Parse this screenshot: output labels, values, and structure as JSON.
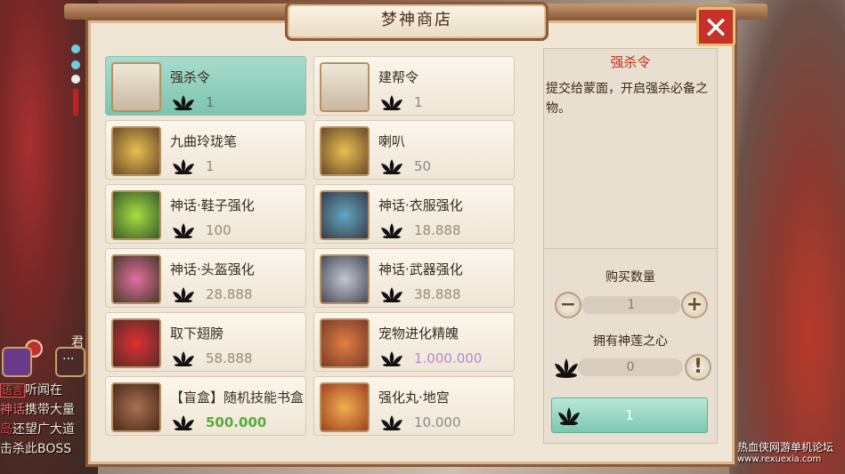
{
  "window": {
    "title": "梦神商店"
  },
  "items": [
    {
      "name": "强杀令",
      "price": "1",
      "icon": "seal-scroll-icon",
      "selected": true
    },
    {
      "name": "建帮令",
      "price": "1",
      "icon": "scroll-icon"
    },
    {
      "name": "九曲玲珑笔",
      "price": "1",
      "icon": "brush-icon"
    },
    {
      "name": "喇叭",
      "price": "50",
      "icon": "trumpet-icon"
    },
    {
      "name": "神话·鞋子强化",
      "price": "100",
      "icon": "green-flame-icon"
    },
    {
      "name": "神话·衣服强化",
      "price": "18.888",
      "icon": "robe-icon"
    },
    {
      "name": "神话·头盔强化",
      "price": "28.888",
      "icon": "helmet-icon"
    },
    {
      "name": "神话·武器强化",
      "price": "38.888",
      "icon": "weapon-icon"
    },
    {
      "name": "取下翅膀",
      "price": "58.888",
      "icon": "red-drop-icon"
    },
    {
      "name": "宠物进化精魄",
      "price": "1.000.000",
      "icon": "rolled-scroll-icon"
    },
    {
      "name": "【盲盒】随机技能书盒",
      "price": "500.000",
      "icon": "book-box-icon"
    },
    {
      "name": "强化丸·地宫",
      "price": "10.000",
      "icon": "orb-icon"
    }
  ],
  "detail": {
    "title": "强杀令",
    "description": "提交给蒙面，开启强杀必备之物。",
    "quantity_label": "购买数量",
    "quantity": "1",
    "own_label": "拥有神莲之心",
    "own_count": "0",
    "buy_cost": "1"
  },
  "side": {
    "label": "君"
  },
  "chat": {
    "line1_tag": "语言",
    "line1": "听闻在",
    "line2_prefix": "神话",
    "line2": "携带大量",
    "line3_prefix": "岛",
    "line3": "还望广大道",
    "line4": "击杀此BOSS"
  },
  "watermark": {
    "text": "热血侠网游单机论坛",
    "site": "www.rexuexia.com"
  },
  "colors": {
    "accent_green": "#7cc4b0",
    "frame": "#8a5a3a",
    "close_red": "#c8302a"
  }
}
